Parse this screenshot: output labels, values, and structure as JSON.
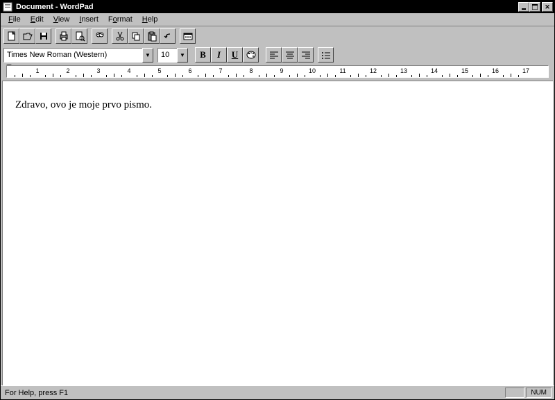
{
  "title": "Document - WordPad",
  "menu": [
    "File",
    "Edit",
    "View",
    "Insert",
    "Format",
    "Help"
  ],
  "menu_u": [
    "F",
    "E",
    "V",
    "I",
    "o",
    "H"
  ],
  "font_name": "Times New Roman (Western)",
  "font_size": "10",
  "ruler_numbers": [
    1,
    2,
    3,
    4,
    5,
    6,
    7,
    8,
    9,
    10,
    11,
    12,
    13,
    14,
    15,
    16,
    17
  ],
  "document_text": "Zdravo, ovo je moje prvo pismo.",
  "status_text": "For Help, press F1",
  "status_num": "NUM",
  "toolbar": {
    "new": "New",
    "open": "Open",
    "save": "Save",
    "print": "Print",
    "preview": "Preview",
    "find": "Find",
    "cut": "Cut",
    "copy": "Copy",
    "paste": "Paste",
    "undo": "Undo",
    "datetime": "DateTime"
  },
  "format": {
    "bold": "B",
    "italic": "I",
    "underline": "U",
    "color": "Color",
    "left": "Left",
    "center": "Center",
    "right": "Right",
    "bullets": "Bullets"
  }
}
